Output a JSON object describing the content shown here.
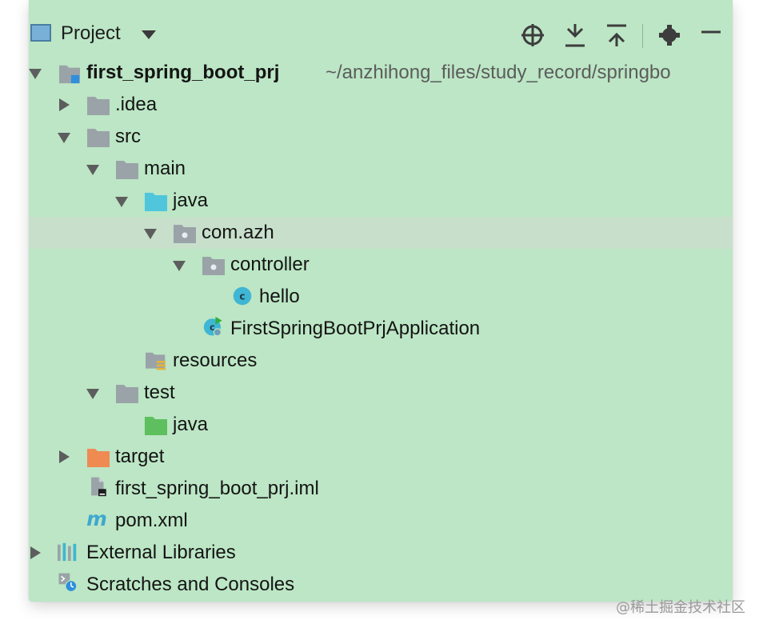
{
  "header": {
    "label": "Project"
  },
  "tree": {
    "root": {
      "name": "first_spring_boot_prj",
      "path": "~/anzhihong_files/study_record/springbo"
    },
    "idea": ".idea",
    "src": "src",
    "main": "main",
    "main_java": "java",
    "com_azh": "com.azh",
    "controller": "controller",
    "hello": "hello",
    "app_class": "FirstSpringBootPrjApplication",
    "resources": "resources",
    "test": "test",
    "test_java": "java",
    "target": "target",
    "iml": "first_spring_boot_prj.iml",
    "pom": "pom.xml",
    "external_libraries": "External Libraries",
    "scratches": "Scratches and Consoles"
  },
  "watermark": "@稀土掘金技术社区",
  "colors": {
    "panel_bg": "#bce6c5",
    "selected_row": "#c8e0cb",
    "folder_gray": "#9aa3a8",
    "source_folder_blue": "#4fc6dc",
    "test_folder_green": "#5ebf5e",
    "target_folder_orange": "#ee8a52",
    "class_icon_cyan": "#3fb6d3"
  }
}
